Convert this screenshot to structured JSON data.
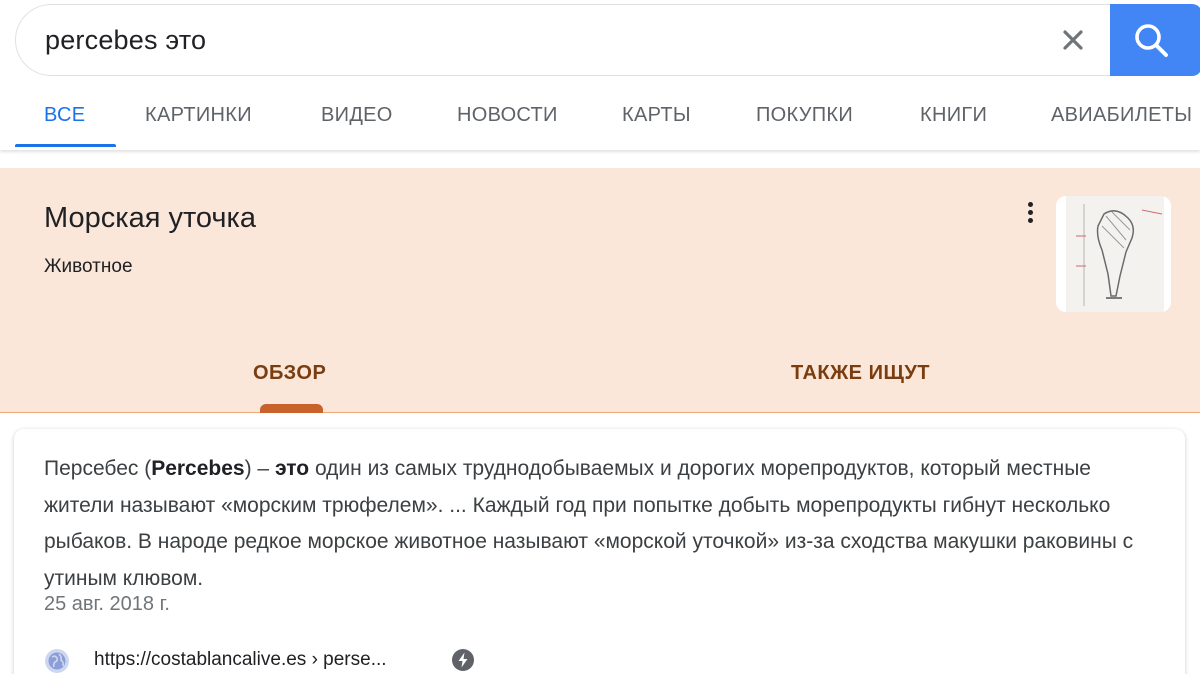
{
  "search": {
    "query": "percebes это"
  },
  "tabs": [
    {
      "label": "ВСЕ",
      "active": true
    },
    {
      "label": "КАРТИНКИ"
    },
    {
      "label": "ВИДЕО"
    },
    {
      "label": "НОВОСТИ"
    },
    {
      "label": "КАРТЫ"
    },
    {
      "label": "ПОКУПКИ"
    },
    {
      "label": "КНИГИ"
    },
    {
      "label": "АВИАБИЛЕТЫ"
    }
  ],
  "knowledge_panel": {
    "title": "Морская уточка",
    "subtitle": "Животное",
    "tabs": [
      {
        "label": "ОБЗОР",
        "active": true
      },
      {
        "label": "ТАКЖЕ ИЩУТ"
      }
    ]
  },
  "result": {
    "snippet": {
      "p1": "Персебес (",
      "b1": "Percebes",
      "p2": ") – ",
      "b2": "это",
      "p3": " один из самых труднодобываемых и дорогих морепродуктов, который местные жители называют «морским трюфелем». ... Каждый год при попытке добыть морепродукты гибнут несколько рыбаков. В народе редкое морское животное называют «морской уточкой» из-за сходства макушки раковины с утиным клювом."
    },
    "date": "25 авг. 2018 г.",
    "url": "https://costablancalive.es › perse..."
  },
  "colors": {
    "accent": "#1a73e8",
    "search_button": "#4285f4",
    "panel_bg": "#fbe7d9",
    "panel_tab_text": "#7a3d10",
    "panel_tab_indicator": "#c9612a"
  },
  "icons": [
    "close-icon",
    "search-icon",
    "more-vert-icon",
    "globe-icon",
    "amp-lightning-icon"
  ]
}
